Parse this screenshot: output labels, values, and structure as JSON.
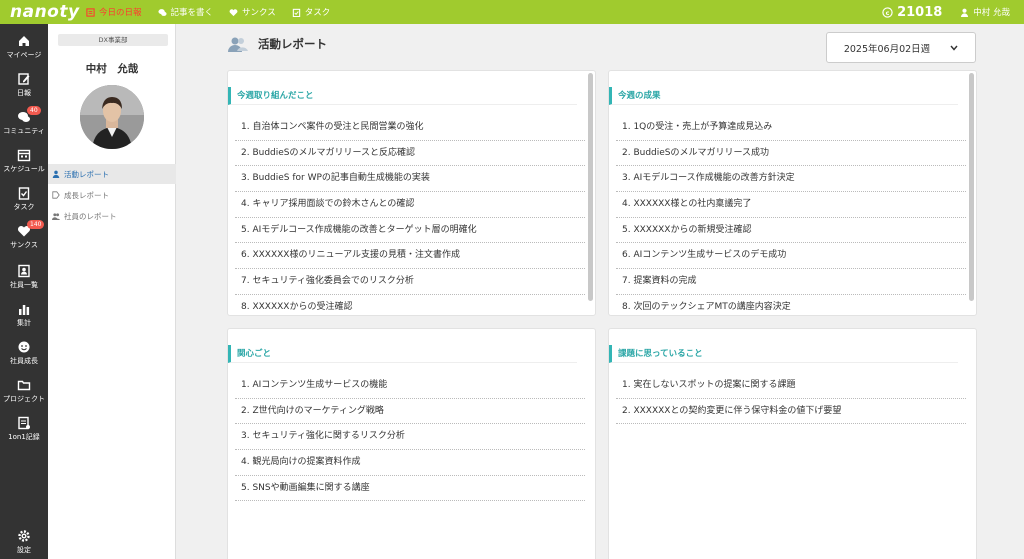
{
  "topbar": {
    "logo": "nanoty",
    "nav": [
      {
        "label": "今日の日報",
        "icon": "diary-icon",
        "active": true
      },
      {
        "label": "記事を書く",
        "icon": "chat-icon",
        "active": false
      },
      {
        "label": "サンクス",
        "icon": "heart-icon",
        "active": false
      },
      {
        "label": "タスク",
        "icon": "task-icon",
        "active": false
      }
    ],
    "points": "21018",
    "user": "中村 允哉"
  },
  "iconbar": {
    "items": [
      {
        "label": "マイページ",
        "icon": "home-icon"
      },
      {
        "label": "日報",
        "icon": "edit-icon"
      },
      {
        "label": "コミュニティ",
        "icon": "chat-icon",
        "badge": "40"
      },
      {
        "label": "スケジュール",
        "icon": "calendar-icon"
      },
      {
        "label": "タスク",
        "icon": "clipboard-icon"
      },
      {
        "label": "サンクス",
        "icon": "heart-icon",
        "badge": "140"
      },
      {
        "label": "社員一覧",
        "icon": "id-card-icon"
      },
      {
        "label": "集計",
        "icon": "bar-chart-icon"
      },
      {
        "label": "社員成長",
        "icon": "smile-icon"
      },
      {
        "label": "プロジェクト",
        "icon": "folder-icon"
      },
      {
        "label": "1on1記録",
        "icon": "note-icon"
      },
      {
        "label": "設定",
        "icon": "gear-icon"
      }
    ]
  },
  "profile": {
    "department": "DX事業部",
    "name": "中村　允哉"
  },
  "subnav": [
    {
      "label": "活動レポート",
      "icon": "user-icon",
      "active": true
    },
    {
      "label": "成長レポート",
      "icon": "tag-icon",
      "active": false
    },
    {
      "label": "社員のレポート",
      "icon": "users-icon",
      "active": false
    }
  ],
  "main": {
    "title": "活動レポート",
    "week_select": "2025年06月02日週"
  },
  "panels": {
    "this_week": {
      "title": "今週取り組んだこと",
      "items": [
        "1. 自治体コンペ案件の受注と民間営業の強化",
        "2. BuddieSのメルマガリリースと反応確認",
        "3. BuddieS for WPの記事自動生成機能の実装",
        "4. キャリア採用面談での鈴木さんとの確認",
        "5. AIモデルコース作成機能の改善とターゲット層の明確化",
        "6. XXXXXX様のリニューアル支援の見積・注文書作成",
        "7. セキュリティ強化委員会でのリスク分析",
        "8. XXXXXXからの受注確認"
      ]
    },
    "results": {
      "title": "今週の成果",
      "items": [
        "1. 1Qの受注・売上が予算達成見込み",
        "2. BuddieSのメルマガリリース成功",
        "3. AIモデルコース作成機能の改善方針決定",
        "4. XXXXXX様との社内稟議完了",
        "5. XXXXXXからの新規受注確認",
        "6. AIコンテンツ生成サービスのデモ成功",
        "7. 提案資料の完成",
        "8. 次回のテックシェアMTの講座内容決定"
      ]
    },
    "interests": {
      "title": "関心ごと",
      "items": [
        "1. AIコンテンツ生成サービスの機能",
        "2. Z世代向けのマーケティング戦略",
        "3. セキュリティ強化に関するリスク分析",
        "4. 観光局向けの提案資料作成",
        "5. SNSや動画編集に関する講座"
      ]
    },
    "issues": {
      "title": "課題に思っていること",
      "items": [
        "1. 実在しないスポットの提案に関する課題",
        "2. XXXXXXとの契約変更に伴う保守料金の値下げ要望"
      ]
    }
  }
}
